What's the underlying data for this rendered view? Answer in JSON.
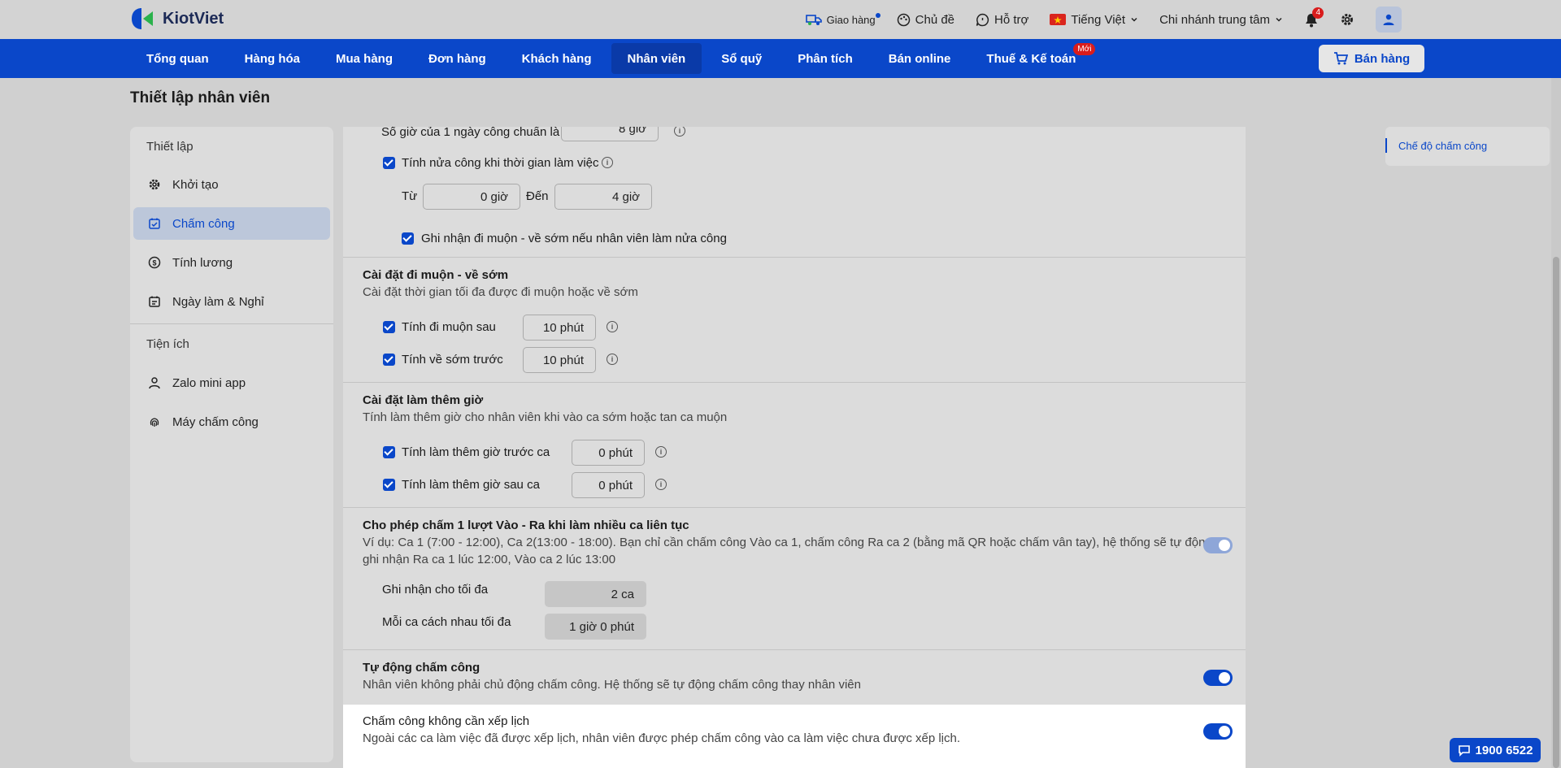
{
  "app": {
    "brand": "KiotViet"
  },
  "topbar": {
    "delivery": "Giao hàng",
    "theme": "Chủ đề",
    "support": "Hỗ trợ",
    "language": "Tiếng Việt",
    "branch": "Chi nhánh trung tâm",
    "notification_count": "4"
  },
  "mainnav": {
    "tabs": [
      "Tổng quan",
      "Hàng hóa",
      "Mua hàng",
      "Đơn hàng",
      "Khách hàng",
      "Nhân viên",
      "Sổ quỹ",
      "Phân tích",
      "Bán online",
      "Thuế & Kế toán"
    ],
    "active": "Nhân viên",
    "new_badge": "Mới",
    "sell_button": "Bán hàng"
  },
  "page": {
    "title": "Thiết lập nhân viên"
  },
  "sidebar": {
    "group1": "Thiết lập",
    "items1": [
      "Khởi tạo",
      "Chấm công",
      "Tính lương",
      "Ngày làm & Nghỉ"
    ],
    "group2": "Tiện ích",
    "items2": [
      "Zalo mini app",
      "Máy chấm công"
    ]
  },
  "content": {
    "std_hours_label": "Số giờ của 1 ngày công chuẩn là",
    "std_hours_value": "8 giờ",
    "half_day_label": "Tính nửa công khi thời gian làm việc",
    "from_label": "Từ",
    "from_value": "0 giờ",
    "to_label": "Đến",
    "to_value": "4 giờ",
    "half_day_late_label": "Ghi nhận đi muộn - về sớm nếu nhân viên làm nửa công",
    "late": {
      "title": "Cài đặt đi muộn - về sớm",
      "desc": "Cài đặt thời gian tối đa được đi muộn hoặc về sớm",
      "late_label": "Tính đi muộn sau",
      "late_value": "10 phút",
      "early_label": "Tính về sớm trước",
      "early_value": "10 phút"
    },
    "overtime": {
      "title": "Cài đặt làm thêm giờ",
      "desc": "Tính làm thêm giờ cho nhân viên khi vào ca sớm hoặc tan ca muộn",
      "before_label": "Tính làm thêm giờ trước ca",
      "before_value": "0 phút",
      "after_label": "Tính làm thêm giờ sau ca",
      "after_value": "0 phút"
    },
    "multi_shift": {
      "title": "Cho phép chấm 1 lượt Vào - Ra khi làm nhiều ca liên tục",
      "desc1": "Ví dụ: Ca 1 (7:00 - 12:00), Ca 2(13:00 - 18:00). Bạn chỉ cần chấm công Vào ca 1, chấm công Ra ca 2 (bằng mã QR hoặc chấm vân tay), hệ thống sẽ tự động",
      "desc2": "ghi nhận Ra ca 1 lúc 12:00, Vào ca 2 lúc 13:00",
      "max_label": "Ghi nhận cho tối đa",
      "max_value": "2 ca",
      "gap_label": "Mỗi ca cách nhau tối đa",
      "gap_value": "1 giờ 0 phút"
    },
    "auto": {
      "title": "Tự động chấm công",
      "desc": "Nhân viên không phải chủ động chấm công. Hệ thống sẽ tự động chấm công thay nhân viên"
    },
    "unscheduled": {
      "title": "Chấm công không cần xếp lịch",
      "desc": "Ngoài các ca làm việc đã được xếp lịch, nhân viên được phép chấm công vào ca làm việc chưa được xếp lịch."
    }
  },
  "rightnav": {
    "item": "Chế độ chấm công"
  },
  "hotline": "1900 6522",
  "colors": {
    "primary": "#0a47c9",
    "badge": "#d91c1c"
  }
}
